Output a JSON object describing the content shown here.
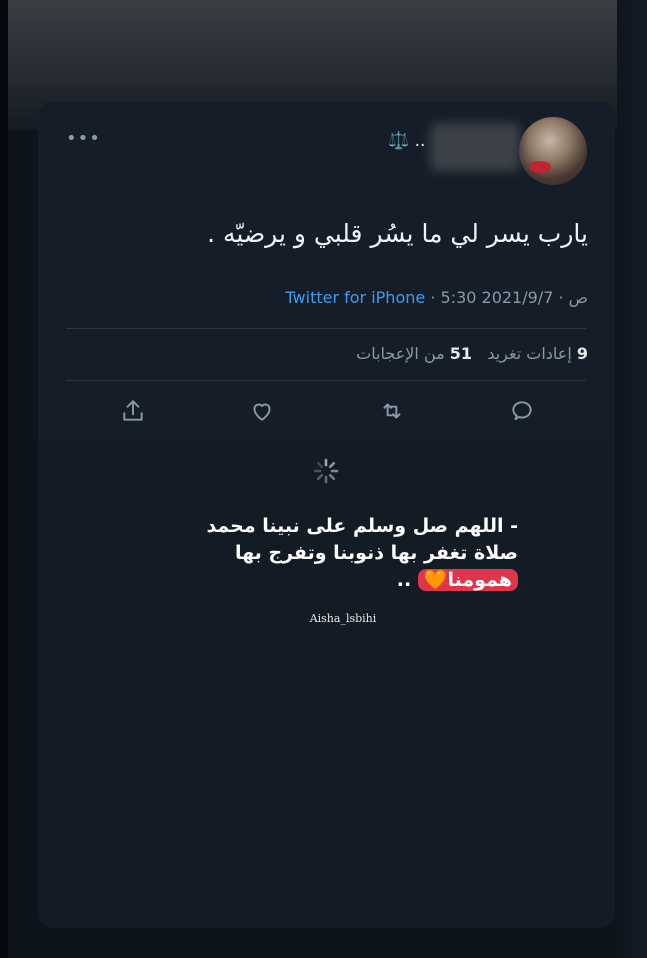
{
  "tweet": {
    "name_suffix": "⚖️ ..",
    "text": "يارب يسر لي ما يسُر قلبي و يرضيّه .",
    "date": "2021/9/7",
    "time": "5:30 ص",
    "separator": "·",
    "source": "Twitter for iPhone",
    "retweets_count": "9",
    "retweets_label": "إعادات تغريد",
    "likes_count": "51",
    "likes_label": "من الإعجابات"
  },
  "icons": {
    "more": "more-horizontal-icon",
    "share": "share-icon",
    "like": "heart-icon",
    "retweet": "retweet-icon",
    "reply": "reply-icon",
    "loading": "loading-spinner-icon"
  },
  "overlay": {
    "line1": "- اللهم صل وسلم على نبينا محمد",
    "line2": "صلاة تغفر بها ذنوبنا وتفرج بها",
    "line3_highlight": "همومنا",
    "line3_heart": "🧡",
    "line3_suffix": "..",
    "author": "Aisha_lsbihi"
  },
  "colors": {
    "card": "#151d28",
    "accent_link": "#3b9df0",
    "highlight": "#e0344a",
    "heart": "#f4a23a"
  }
}
